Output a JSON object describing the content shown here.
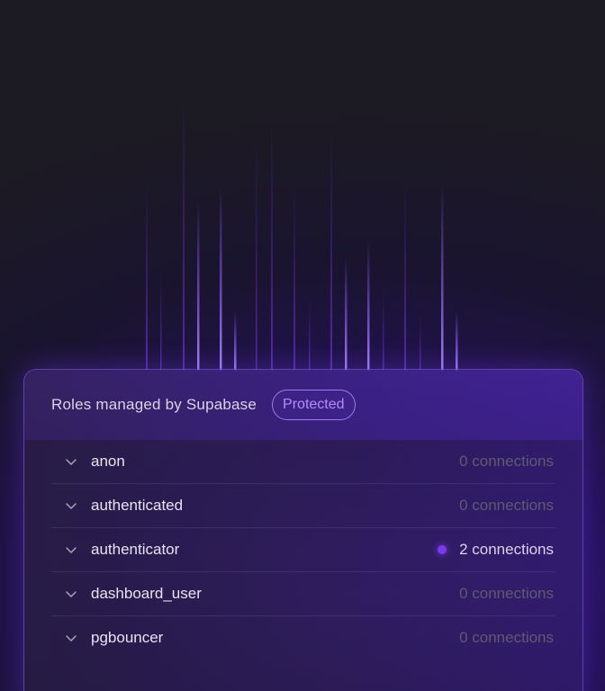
{
  "panel": {
    "title": "Roles managed by Supabase",
    "badge": "Protected"
  },
  "roles": [
    {
      "name": "anon",
      "connections": "0 connections",
      "active": false
    },
    {
      "name": "authenticated",
      "connections": "0 connections",
      "active": false
    },
    {
      "name": "authenticator",
      "connections": "2 connections",
      "active": true
    },
    {
      "name": "dashboard_user",
      "connections": "0 connections",
      "active": false
    },
    {
      "name": "pgbouncer",
      "connections": "0 connections",
      "active": false
    }
  ],
  "icons": {
    "row_toggle": "chevron-down-icon",
    "status": "status-dot-icon"
  },
  "colors": {
    "accent": "#7c3aed",
    "badge": "#b48cff"
  }
}
